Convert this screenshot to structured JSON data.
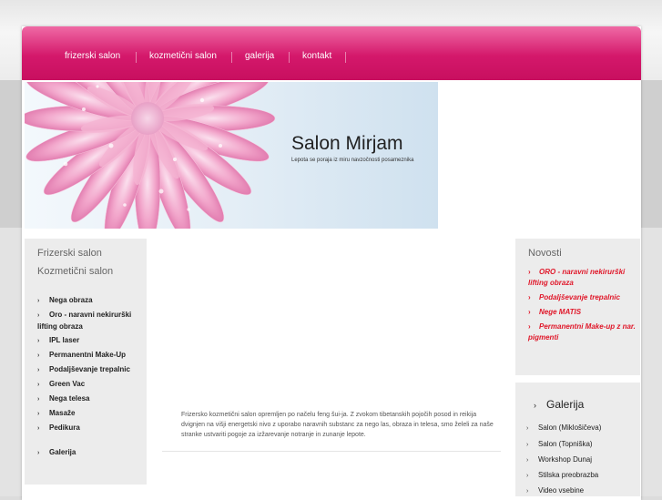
{
  "nav": {
    "items": [
      "frizerski salon",
      "kozmetični salon",
      "galerija",
      "kontakt"
    ]
  },
  "header": {
    "title": "Salon Mirjam",
    "subtitle": "Lepota se poraja iz miru navzočnosti posameznika"
  },
  "left_sidebar": {
    "headings": [
      "Frizerski salon",
      "Kozmetični salon"
    ],
    "items": [
      "Nega obraza",
      "Oro - naravni nekirurški lifting obraza",
      "IPL laser",
      "Permanentni Make-Up",
      "Podaljševanje trepalnic",
      "Green Vac",
      "Nega telesa",
      "Masaže",
      "Pedikura",
      "Galerija"
    ]
  },
  "main": {
    "text": "Frizersko kozmetični salon opremljen po načelu feng šui-ja. Z zvokom tibetanskih pojočih posod in reikija dvignjen na višji energetski nivo z uporabo naravnih substanc za nego las, obraza in telesa, smo želeli za naše stranke ustvariti pogoje za izžarevanje notranje in zunanje lepote."
  },
  "news": {
    "title": "Novosti",
    "items": [
      "ORO - naravni nekirurški lifting obraza",
      "Podaljševanje trepalnic",
      "Nege MATIS",
      "Permanentni Make-up z nar. pigmenti"
    ]
  },
  "gallery": {
    "title": "Galerija",
    "items": [
      "Salon (Miklošičeva)",
      "Salon (Topniška)",
      "Workshop Dunaj",
      "Stilska preobrazba",
      "Video vsebine"
    ]
  },
  "colors": {
    "nav_pink": "#d4186b",
    "news_red": "#e0182a"
  }
}
